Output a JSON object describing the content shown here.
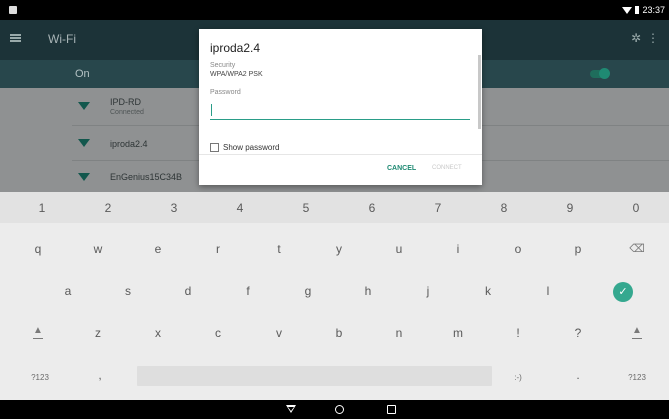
{
  "status_bar": {
    "time": "23:37"
  },
  "app": {
    "title": "Wi-Fi",
    "switch_label": "On",
    "networks": [
      {
        "name": "IPD-RD",
        "status": "Connected"
      },
      {
        "name": "iproda2.4",
        "status": ""
      },
      {
        "name": "EnGenius15C34B",
        "status": ""
      }
    ]
  },
  "dialog": {
    "title": "iproda2.4",
    "security_label": "Security",
    "security_value": "WPA/WPA2 PSK",
    "password_label": "Password",
    "password_value": "",
    "show_password_label": "Show password",
    "cancel_label": "CANCEL",
    "connect_label": "CONNECT"
  },
  "keyboard": {
    "number_row": [
      "1",
      "2",
      "3",
      "4",
      "5",
      "6",
      "7",
      "8",
      "9",
      "0"
    ],
    "row1": [
      "q",
      "w",
      "e",
      "r",
      "t",
      "y",
      "u",
      "i",
      "o",
      "p"
    ],
    "row2": [
      "a",
      "s",
      "d",
      "f",
      "g",
      "h",
      "j",
      "k",
      "l"
    ],
    "row3": [
      "z",
      "x",
      "c",
      "v",
      "b",
      "n",
      "m",
      "!",
      "?"
    ],
    "symbols_left": "?123",
    "comma": ",",
    "emoji": ":-)",
    "period": ".",
    "symbols_right": "?123"
  }
}
